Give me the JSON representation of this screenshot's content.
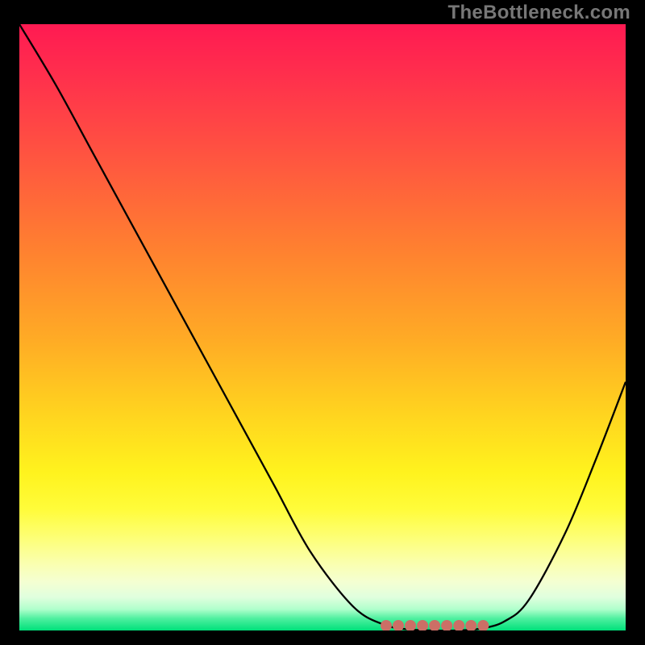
{
  "watermark": "TheBottleneck.com",
  "chart_data": {
    "type": "line",
    "title": "",
    "xlabel": "",
    "ylabel": "",
    "xlim": [
      0,
      1
    ],
    "ylim": [
      0,
      1
    ],
    "series": [
      {
        "name": "curve",
        "x": [
          0.0,
          0.06,
          0.12,
          0.18,
          0.24,
          0.3,
          0.36,
          0.42,
          0.48,
          0.55,
          0.6,
          0.64,
          0.68,
          0.72,
          0.76,
          0.8,
          0.84,
          0.9,
          0.95,
          1.0
        ],
        "y": [
          1.0,
          0.9,
          0.79,
          0.68,
          0.57,
          0.46,
          0.35,
          0.24,
          0.13,
          0.04,
          0.01,
          0.002,
          0.0,
          0.0,
          0.003,
          0.015,
          0.05,
          0.16,
          0.28,
          0.41
        ]
      }
    ],
    "valley_markers_x": [
      0.605,
      0.625,
      0.645,
      0.665,
      0.685,
      0.705,
      0.725,
      0.745,
      0.765
    ],
    "gradient_stops": [
      {
        "pos": 0.0,
        "color": "#ff1a52"
      },
      {
        "pos": 0.5,
        "color": "#ffab25"
      },
      {
        "pos": 0.8,
        "color": "#fffc3a"
      },
      {
        "pos": 1.0,
        "color": "#00e07a"
      }
    ]
  }
}
